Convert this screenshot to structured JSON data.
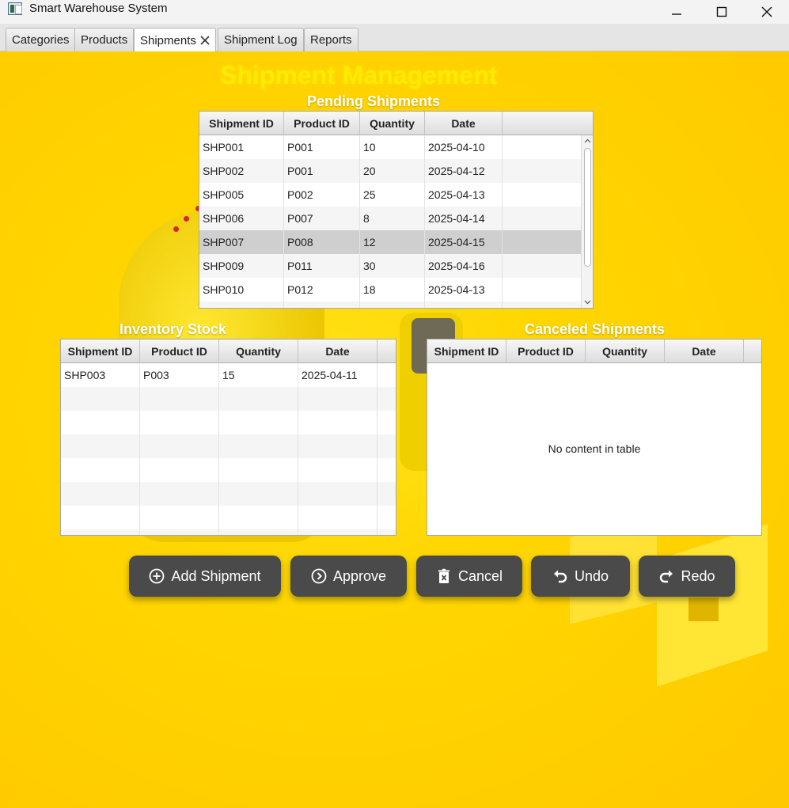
{
  "window": {
    "title": "Smart Warehouse System"
  },
  "tabs": [
    {
      "label": "Categories"
    },
    {
      "label": "Products"
    },
    {
      "label": "Shipments",
      "active": true
    },
    {
      "label": "Shipment Log"
    },
    {
      "label": "Reports"
    }
  ],
  "page": {
    "title": "Shipment Management"
  },
  "pending": {
    "title": "Pending Shipments",
    "columns": [
      "Shipment ID",
      "Product ID",
      "Quantity",
      "Date"
    ],
    "rows": [
      [
        "SHP001",
        "P001",
        "10",
        "2025-04-10"
      ],
      [
        "SHP002",
        "P001",
        "20",
        "2025-04-12"
      ],
      [
        "SHP005",
        "P002",
        "25",
        "2025-04-13"
      ],
      [
        "SHP006",
        "P007",
        "8",
        "2025-04-14"
      ],
      [
        "SHP007",
        "P008",
        "12",
        "2025-04-15"
      ],
      [
        "SHP009",
        "P011",
        "30",
        "2025-04-16"
      ],
      [
        "SHP010",
        "P012",
        "18",
        "2025-04-13"
      ]
    ],
    "selected_row": 4
  },
  "inventory": {
    "title": "Inventory Stock",
    "columns": [
      "Shipment ID",
      "Product ID",
      "Quantity",
      "Date"
    ],
    "rows": [
      [
        "SHP003",
        "P003",
        "15",
        "2025-04-11"
      ]
    ]
  },
  "canceled": {
    "title": "Canceled Shipments",
    "columns": [
      "Shipment ID",
      "Product ID",
      "Quantity",
      "Date"
    ],
    "empty_message": "No content in table"
  },
  "buttons": {
    "add": "Add Shipment",
    "approve": "Approve",
    "cancel": "Cancel",
    "undo": "Undo",
    "redo": "Redo"
  },
  "colors": {
    "background": "#ffd600",
    "button": "#4a4a4a",
    "selected_row": "#cfcfcf"
  }
}
